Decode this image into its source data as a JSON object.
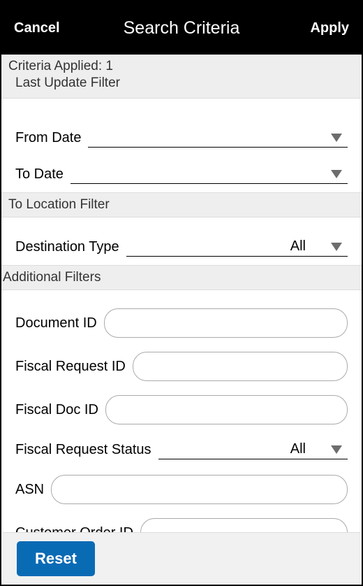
{
  "header": {
    "cancel": "Cancel",
    "title": "Search Criteria",
    "apply": "Apply"
  },
  "criteria": {
    "applied_label": "Criteria Applied: 1",
    "last_update_label": "Last Update Filter"
  },
  "date_filter": {
    "from_label": "From Date",
    "from_value": "",
    "to_label": "To Date",
    "to_value": ""
  },
  "to_location": {
    "section_label": "To Location Filter",
    "destination_type_label": "Destination Type",
    "destination_type_value": "All"
  },
  "additional": {
    "section_label": "Additional Filters",
    "document_id_label": "Document ID",
    "document_id_value": "",
    "fiscal_request_id_label": "Fiscal Request ID",
    "fiscal_request_id_value": "",
    "fiscal_doc_id_label": "Fiscal Doc ID",
    "fiscal_doc_id_value": "",
    "fiscal_request_status_label": "Fiscal Request Status",
    "fiscal_request_status_value": "All",
    "asn_label": "ASN",
    "asn_value": "",
    "customer_order_id_label": "Customer Order ID",
    "customer_order_id_value": ""
  },
  "footer": {
    "reset": "Reset"
  }
}
